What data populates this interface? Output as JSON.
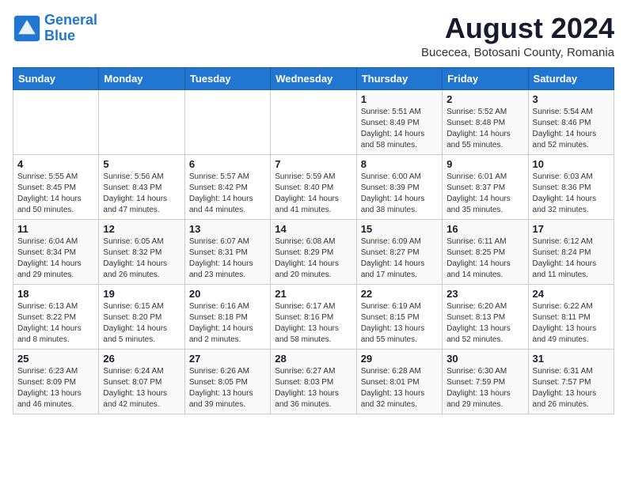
{
  "header": {
    "logo_line1": "General",
    "logo_line2": "Blue",
    "month_year": "August 2024",
    "location": "Bucecea, Botosani County, Romania"
  },
  "days_of_week": [
    "Sunday",
    "Monday",
    "Tuesday",
    "Wednesday",
    "Thursday",
    "Friday",
    "Saturday"
  ],
  "weeks": [
    [
      {
        "day": "",
        "info": ""
      },
      {
        "day": "",
        "info": ""
      },
      {
        "day": "",
        "info": ""
      },
      {
        "day": "",
        "info": ""
      },
      {
        "day": "1",
        "info": "Sunrise: 5:51 AM\nSunset: 8:49 PM\nDaylight: 14 hours\nand 58 minutes."
      },
      {
        "day": "2",
        "info": "Sunrise: 5:52 AM\nSunset: 8:48 PM\nDaylight: 14 hours\nand 55 minutes."
      },
      {
        "day": "3",
        "info": "Sunrise: 5:54 AM\nSunset: 8:46 PM\nDaylight: 14 hours\nand 52 minutes."
      }
    ],
    [
      {
        "day": "4",
        "info": "Sunrise: 5:55 AM\nSunset: 8:45 PM\nDaylight: 14 hours\nand 50 minutes."
      },
      {
        "day": "5",
        "info": "Sunrise: 5:56 AM\nSunset: 8:43 PM\nDaylight: 14 hours\nand 47 minutes."
      },
      {
        "day": "6",
        "info": "Sunrise: 5:57 AM\nSunset: 8:42 PM\nDaylight: 14 hours\nand 44 minutes."
      },
      {
        "day": "7",
        "info": "Sunrise: 5:59 AM\nSunset: 8:40 PM\nDaylight: 14 hours\nand 41 minutes."
      },
      {
        "day": "8",
        "info": "Sunrise: 6:00 AM\nSunset: 8:39 PM\nDaylight: 14 hours\nand 38 minutes."
      },
      {
        "day": "9",
        "info": "Sunrise: 6:01 AM\nSunset: 8:37 PM\nDaylight: 14 hours\nand 35 minutes."
      },
      {
        "day": "10",
        "info": "Sunrise: 6:03 AM\nSunset: 8:36 PM\nDaylight: 14 hours\nand 32 minutes."
      }
    ],
    [
      {
        "day": "11",
        "info": "Sunrise: 6:04 AM\nSunset: 8:34 PM\nDaylight: 14 hours\nand 29 minutes."
      },
      {
        "day": "12",
        "info": "Sunrise: 6:05 AM\nSunset: 8:32 PM\nDaylight: 14 hours\nand 26 minutes."
      },
      {
        "day": "13",
        "info": "Sunrise: 6:07 AM\nSunset: 8:31 PM\nDaylight: 14 hours\nand 23 minutes."
      },
      {
        "day": "14",
        "info": "Sunrise: 6:08 AM\nSunset: 8:29 PM\nDaylight: 14 hours\nand 20 minutes."
      },
      {
        "day": "15",
        "info": "Sunrise: 6:09 AM\nSunset: 8:27 PM\nDaylight: 14 hours\nand 17 minutes."
      },
      {
        "day": "16",
        "info": "Sunrise: 6:11 AM\nSunset: 8:25 PM\nDaylight: 14 hours\nand 14 minutes."
      },
      {
        "day": "17",
        "info": "Sunrise: 6:12 AM\nSunset: 8:24 PM\nDaylight: 14 hours\nand 11 minutes."
      }
    ],
    [
      {
        "day": "18",
        "info": "Sunrise: 6:13 AM\nSunset: 8:22 PM\nDaylight: 14 hours\nand 8 minutes."
      },
      {
        "day": "19",
        "info": "Sunrise: 6:15 AM\nSunset: 8:20 PM\nDaylight: 14 hours\nand 5 minutes."
      },
      {
        "day": "20",
        "info": "Sunrise: 6:16 AM\nSunset: 8:18 PM\nDaylight: 14 hours\nand 2 minutes."
      },
      {
        "day": "21",
        "info": "Sunrise: 6:17 AM\nSunset: 8:16 PM\nDaylight: 13 hours\nand 58 minutes."
      },
      {
        "day": "22",
        "info": "Sunrise: 6:19 AM\nSunset: 8:15 PM\nDaylight: 13 hours\nand 55 minutes."
      },
      {
        "day": "23",
        "info": "Sunrise: 6:20 AM\nSunset: 8:13 PM\nDaylight: 13 hours\nand 52 minutes."
      },
      {
        "day": "24",
        "info": "Sunrise: 6:22 AM\nSunset: 8:11 PM\nDaylight: 13 hours\nand 49 minutes."
      }
    ],
    [
      {
        "day": "25",
        "info": "Sunrise: 6:23 AM\nSunset: 8:09 PM\nDaylight: 13 hours\nand 46 minutes."
      },
      {
        "day": "26",
        "info": "Sunrise: 6:24 AM\nSunset: 8:07 PM\nDaylight: 13 hours\nand 42 minutes."
      },
      {
        "day": "27",
        "info": "Sunrise: 6:26 AM\nSunset: 8:05 PM\nDaylight: 13 hours\nand 39 minutes."
      },
      {
        "day": "28",
        "info": "Sunrise: 6:27 AM\nSunset: 8:03 PM\nDaylight: 13 hours\nand 36 minutes."
      },
      {
        "day": "29",
        "info": "Sunrise: 6:28 AM\nSunset: 8:01 PM\nDaylight: 13 hours\nand 32 minutes."
      },
      {
        "day": "30",
        "info": "Sunrise: 6:30 AM\nSunset: 7:59 PM\nDaylight: 13 hours\nand 29 minutes."
      },
      {
        "day": "31",
        "info": "Sunrise: 6:31 AM\nSunset: 7:57 PM\nDaylight: 13 hours\nand 26 minutes."
      }
    ]
  ]
}
